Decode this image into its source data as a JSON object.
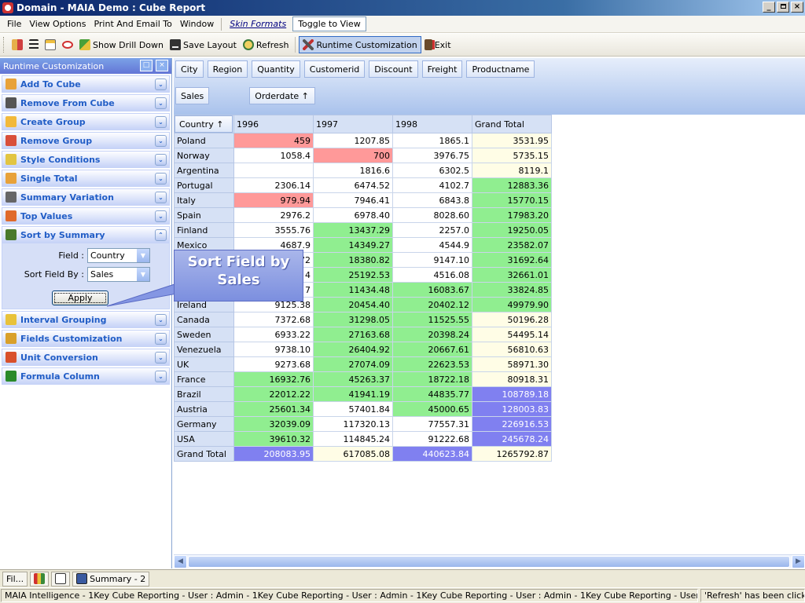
{
  "window": {
    "title": "Domain - MAIA Demo : Cube Report",
    "btn_min": "_",
    "btn_max": " ",
    "btn_close": "×"
  },
  "menu": [
    {
      "label": "File"
    },
    {
      "label": "View Options"
    },
    {
      "label": "Print And Email To"
    },
    {
      "label": "Window"
    }
  ],
  "menu_skin": "Skin Formats",
  "menu_toggle": "Toggle to View",
  "toolbar": {
    "show_drill_down": "Show Drill Down",
    "save_layout": "Save Layout",
    "refresh": "Refresh",
    "runtime_customization": "Runtime Customization",
    "exit": "Exit"
  },
  "panel": {
    "title": "Runtime Customization",
    "items_top": [
      {
        "label": "Add To Cube",
        "icon": "add-cube-icon",
        "color": "#e8a23a"
      },
      {
        "label": "Remove From Cube",
        "icon": "remove-cube-icon",
        "color": "#555555"
      },
      {
        "label": "Create Group",
        "icon": "create-group-icon",
        "color": "#f2b93b"
      },
      {
        "label": "Remove Group",
        "icon": "remove-group-icon",
        "color": "#d94f3a"
      },
      {
        "label": "Style Conditions",
        "icon": "style-conditions-icon",
        "color": "#e2c542"
      },
      {
        "label": "Single Total",
        "icon": "single-total-icon",
        "color": "#e8a23a"
      },
      {
        "label": "Summary Variation",
        "icon": "summary-variation-icon",
        "color": "#666666"
      },
      {
        "label": "Top Values",
        "icon": "top-values-icon",
        "color": "#e06a2a"
      }
    ],
    "expanded": {
      "label": "Sort by Summary",
      "icon": "sort-summary-icon",
      "color": "#4a7a2a",
      "field_label": "Field :",
      "field_value": "Country",
      "sortby_label": "Sort Field By :",
      "sortby_value": "Sales",
      "apply": "Apply"
    },
    "items_bottom": [
      {
        "label": "Interval Grouping",
        "icon": "interval-grouping-icon",
        "color": "#e8c23a"
      },
      {
        "label": "Fields Customization",
        "icon": "fields-customization-icon",
        "color": "#d9a02a"
      },
      {
        "label": "Unit Conversion",
        "icon": "unit-conversion-icon",
        "color": "#d9502a"
      },
      {
        "label": "Formula Column",
        "icon": "formula-column-icon",
        "color": "#2a8a2a"
      }
    ]
  },
  "filter_fields": [
    "City",
    "Region",
    "Quantity",
    "Customerid",
    "Discount",
    "Freight",
    "Productname"
  ],
  "data_field": "Sales",
  "column_field": "Orderdate ↑",
  "row_field": "Country ↑",
  "columns": [
    "1996",
    "1997",
    "1998",
    "Grand Total"
  ],
  "rows": [
    {
      "country": "Poland",
      "v": [
        "459",
        "1207.85",
        "1865.1",
        "3531.95"
      ],
      "c": [
        "red",
        "",
        "",
        "yellow"
      ]
    },
    {
      "country": "Norway",
      "v": [
        "1058.4",
        "700",
        "3976.75",
        "5735.15"
      ],
      "c": [
        "",
        "red",
        "",
        "yellow"
      ]
    },
    {
      "country": "Argentina",
      "v": [
        "",
        "1816.6",
        "6302.5",
        "8119.1"
      ],
      "c": [
        "",
        "",
        "",
        "yellow"
      ]
    },
    {
      "country": "Portugal",
      "v": [
        "2306.14",
        "6474.52",
        "4102.7",
        "12883.36"
      ],
      "c": [
        "",
        "",
        "",
        "green"
      ]
    },
    {
      "country": "Italy",
      "v": [
        "979.94",
        "7946.41",
        "6843.8",
        "15770.15"
      ],
      "c": [
        "red",
        "",
        "",
        "green"
      ]
    },
    {
      "country": "Spain",
      "v": [
        "2976.2",
        "6978.40",
        "8028.60",
        "17983.20"
      ],
      "c": [
        "",
        "",
        "",
        "green"
      ]
    },
    {
      "country": "Finland",
      "v": [
        "3555.76",
        "13437.29",
        "2257.0",
        "19250.05"
      ],
      "c": [
        "",
        "green",
        "",
        "green"
      ]
    },
    {
      "country": "Mexico",
      "v": [
        "4687.9",
        "14349.27",
        "4544.9",
        "23582.07"
      ],
      "c": [
        "",
        "green",
        "",
        "green"
      ]
    },
    {
      "country": "",
      "v": [
        "72",
        "18380.82",
        "9147.10",
        "31692.64"
      ],
      "c": [
        "",
        "green",
        "",
        "green"
      ]
    },
    {
      "country": "",
      "v": [
        "4",
        "25192.53",
        "4516.08",
        "32661.01"
      ],
      "c": [
        "",
        "green",
        "",
        "green"
      ]
    },
    {
      "country": "",
      "v": [
        "7",
        "11434.48",
        "16083.67",
        "33824.85"
      ],
      "c": [
        "",
        "green",
        "green",
        "green"
      ]
    },
    {
      "country": "Ireland",
      "v": [
        "9125.38",
        "20454.40",
        "20402.12",
        "49979.90"
      ],
      "c": [
        "",
        "green",
        "green",
        "green"
      ]
    },
    {
      "country": "Canada",
      "v": [
        "7372.68",
        "31298.05",
        "11525.55",
        "50196.28"
      ],
      "c": [
        "",
        "green",
        "green",
        "yellow"
      ]
    },
    {
      "country": "Sweden",
      "v": [
        "6933.22",
        "27163.68",
        "20398.24",
        "54495.14"
      ],
      "c": [
        "",
        "green",
        "green",
        "yellow"
      ]
    },
    {
      "country": "Venezuela",
      "v": [
        "9738.10",
        "26404.92",
        "20667.61",
        "56810.63"
      ],
      "c": [
        "",
        "green",
        "green",
        "yellow"
      ]
    },
    {
      "country": "UK",
      "v": [
        "9273.68",
        "27074.09",
        "22623.53",
        "58971.30"
      ],
      "c": [
        "",
        "green",
        "green",
        "yellow"
      ]
    },
    {
      "country": "France",
      "v": [
        "16932.76",
        "45263.37",
        "18722.18",
        "80918.31"
      ],
      "c": [
        "green",
        "green",
        "green",
        "yellow"
      ]
    },
    {
      "country": "Brazil",
      "v": [
        "22012.22",
        "41941.19",
        "44835.77",
        "108789.18"
      ],
      "c": [
        "green",
        "green",
        "green",
        "blue"
      ]
    },
    {
      "country": "Austria",
      "v": [
        "25601.34",
        "57401.84",
        "45000.65",
        "128003.83"
      ],
      "c": [
        "green",
        "",
        "green",
        "blue"
      ]
    },
    {
      "country": "Germany",
      "v": [
        "32039.09",
        "117320.13",
        "77557.31",
        "226916.53"
      ],
      "c": [
        "green",
        "",
        "",
        "blue"
      ]
    },
    {
      "country": "USA",
      "v": [
        "39610.32",
        "114845.24",
        "91222.68",
        "245678.24"
      ],
      "c": [
        "green",
        "",
        "",
        "blue"
      ]
    }
  ],
  "grand_total": {
    "label": "Grand Total",
    "v": [
      "208083.95",
      "617085.08",
      "440623.84",
      "1265792.87"
    ],
    "c": [
      "blue",
      "yellow",
      "blue",
      "yellow"
    ]
  },
  "callout": {
    "line1": "Sort Field by",
    "line2": "Sales"
  },
  "bottom_tabs": [
    "Fil...",
    "Summary - 2"
  ],
  "status": {
    "main": "MAIA Intelligence - 1Key Cube Reporting - User : Admin - 1Key Cube Reporting - User : Admin - 1Key Cube Reporting - User : Admin - 1Key Cube Reporting - User : Admin",
    "right": "'Refresh' has been clicked"
  },
  "colors": {
    "red": "#ff9999",
    "green": "#90ee90",
    "blue": "#8080f0",
    "yellow": "#fffde6"
  }
}
